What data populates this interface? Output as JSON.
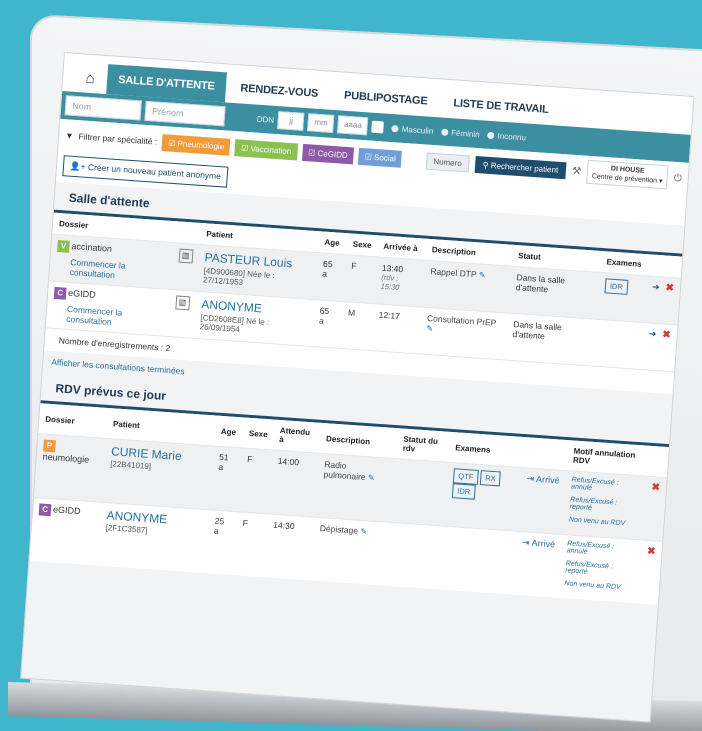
{
  "nav": {
    "tabs": [
      "SALLE D'ATTENTE",
      "RENDEZ-VOUS",
      "PUBLIPOSTAGE",
      "LISTE DE TRAVAIL"
    ]
  },
  "search": {
    "nom_placeholder": "Nom",
    "prenom_placeholder": "Prénom",
    "ddn_label": "DDN",
    "jj": "jj",
    "mm": "mm",
    "aaaa": "aaaa",
    "sex_options": [
      "Masculin",
      "Féminin",
      "Inconnu"
    ]
  },
  "filter": {
    "label": "Filtrer par spécialité :",
    "chips": [
      {
        "label": "Pneumologie",
        "color": "#f39b3a"
      },
      {
        "label": "Vaccination",
        "color": "#8cc152"
      },
      {
        "label": "CeGIDD",
        "color": "#8e5aa8"
      },
      {
        "label": "Social",
        "color": "#6f9fd8"
      }
    ],
    "numero": "Numero",
    "search_button": "Rechercher patient",
    "site": "DI HOUSE",
    "centre": "Centre de prévention"
  },
  "create_button": "Créer un nouveau patient anonyme",
  "waiting": {
    "title": "Salle d'attente",
    "headers": [
      "Dossier",
      "Patient",
      "Age",
      "Sexe",
      "Arrivée à",
      "Description",
      "Statut",
      "Examens"
    ],
    "rows": [
      {
        "badge": "V",
        "badge_color": "#8cc152",
        "specialty": "accination",
        "action": "Commencer la consultation",
        "name": "PASTEUR Louis",
        "sub": "[4D900680] Née le : 27/12/1953",
        "age": "65 a",
        "sex": "F",
        "arrival": "13:40",
        "arrival2": "(rdv : 15:30",
        "description": "Rappel DTP",
        "status": "Dans la salle d'attente",
        "exam": "IDR"
      },
      {
        "badge": "C",
        "badge_color": "#8e5aa8",
        "specialty": "eGIDD",
        "action": "Commencer la consultation",
        "name": "ANONYME",
        "sub": "[CD2608E8] Né le : 26/09/1954",
        "age": "65 a",
        "sex": "M",
        "arrival": "12:17",
        "arrival2": "",
        "description": "Consultation PrEP",
        "status": "Dans la salle d'attente",
        "exam": ""
      }
    ],
    "count": "Nombre d'enregistrements : 2",
    "show_done": "Afficher les consultations terminées"
  },
  "rdv": {
    "title": "RDV prévus ce jour",
    "headers": [
      "Dossier",
      "Patient",
      "Age",
      "Sexe",
      "Attendu à",
      "Description",
      "Statut du rdv",
      "Examens",
      "",
      "Motif annulation RDV"
    ],
    "rows": [
      {
        "badge": "P",
        "badge_color": "#f39b3a",
        "specialty": "neumologie",
        "name": "CURIE Marie",
        "code": "[22B41019]",
        "age": "51 a",
        "sex": "F",
        "expected": "14:00",
        "description": "Radio pulmonaire",
        "exams": [
          "QTF",
          "RX",
          "IDR"
        ],
        "arrive": "Arrivé",
        "motifs": [
          "Refus/Excusé : annulé",
          "Refus/Excusé : reporté",
          "Non venu au RDV"
        ]
      },
      {
        "badge": "C",
        "badge_color": "#8e5aa8",
        "specialty": "eGIDD",
        "name": "ANONYME",
        "code": "[2F1C3587]",
        "age": "25 a",
        "sex": "F",
        "expected": "14:30",
        "description": "Dépistage",
        "exams": [],
        "arrive": "Arrivé",
        "motifs": [
          "Refus/Excusé : annulé",
          "Refus/Excusé : reporté",
          "Non venu au RDV"
        ]
      }
    ]
  }
}
